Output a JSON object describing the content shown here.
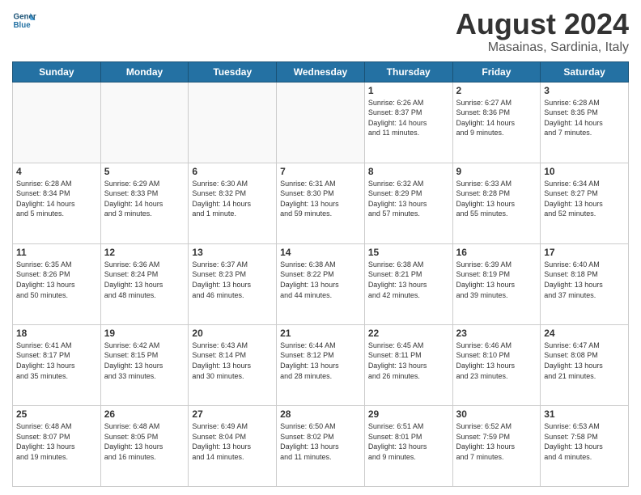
{
  "header": {
    "logo_line1": "General",
    "logo_line2": "Blue",
    "main_title": "August 2024",
    "subtitle": "Masainas, Sardinia, Italy"
  },
  "weekdays": [
    "Sunday",
    "Monday",
    "Tuesday",
    "Wednesday",
    "Thursday",
    "Friday",
    "Saturday"
  ],
  "weeks": [
    [
      {
        "day": "",
        "info": ""
      },
      {
        "day": "",
        "info": ""
      },
      {
        "day": "",
        "info": ""
      },
      {
        "day": "",
        "info": ""
      },
      {
        "day": "1",
        "info": "Sunrise: 6:26 AM\nSunset: 8:37 PM\nDaylight: 14 hours\nand 11 minutes."
      },
      {
        "day": "2",
        "info": "Sunrise: 6:27 AM\nSunset: 8:36 PM\nDaylight: 14 hours\nand 9 minutes."
      },
      {
        "day": "3",
        "info": "Sunrise: 6:28 AM\nSunset: 8:35 PM\nDaylight: 14 hours\nand 7 minutes."
      }
    ],
    [
      {
        "day": "4",
        "info": "Sunrise: 6:28 AM\nSunset: 8:34 PM\nDaylight: 14 hours\nand 5 minutes."
      },
      {
        "day": "5",
        "info": "Sunrise: 6:29 AM\nSunset: 8:33 PM\nDaylight: 14 hours\nand 3 minutes."
      },
      {
        "day": "6",
        "info": "Sunrise: 6:30 AM\nSunset: 8:32 PM\nDaylight: 14 hours\nand 1 minute."
      },
      {
        "day": "7",
        "info": "Sunrise: 6:31 AM\nSunset: 8:30 PM\nDaylight: 13 hours\nand 59 minutes."
      },
      {
        "day": "8",
        "info": "Sunrise: 6:32 AM\nSunset: 8:29 PM\nDaylight: 13 hours\nand 57 minutes."
      },
      {
        "day": "9",
        "info": "Sunrise: 6:33 AM\nSunset: 8:28 PM\nDaylight: 13 hours\nand 55 minutes."
      },
      {
        "day": "10",
        "info": "Sunrise: 6:34 AM\nSunset: 8:27 PM\nDaylight: 13 hours\nand 52 minutes."
      }
    ],
    [
      {
        "day": "11",
        "info": "Sunrise: 6:35 AM\nSunset: 8:26 PM\nDaylight: 13 hours\nand 50 minutes."
      },
      {
        "day": "12",
        "info": "Sunrise: 6:36 AM\nSunset: 8:24 PM\nDaylight: 13 hours\nand 48 minutes."
      },
      {
        "day": "13",
        "info": "Sunrise: 6:37 AM\nSunset: 8:23 PM\nDaylight: 13 hours\nand 46 minutes."
      },
      {
        "day": "14",
        "info": "Sunrise: 6:38 AM\nSunset: 8:22 PM\nDaylight: 13 hours\nand 44 minutes."
      },
      {
        "day": "15",
        "info": "Sunrise: 6:38 AM\nSunset: 8:21 PM\nDaylight: 13 hours\nand 42 minutes."
      },
      {
        "day": "16",
        "info": "Sunrise: 6:39 AM\nSunset: 8:19 PM\nDaylight: 13 hours\nand 39 minutes."
      },
      {
        "day": "17",
        "info": "Sunrise: 6:40 AM\nSunset: 8:18 PM\nDaylight: 13 hours\nand 37 minutes."
      }
    ],
    [
      {
        "day": "18",
        "info": "Sunrise: 6:41 AM\nSunset: 8:17 PM\nDaylight: 13 hours\nand 35 minutes."
      },
      {
        "day": "19",
        "info": "Sunrise: 6:42 AM\nSunset: 8:15 PM\nDaylight: 13 hours\nand 33 minutes."
      },
      {
        "day": "20",
        "info": "Sunrise: 6:43 AM\nSunset: 8:14 PM\nDaylight: 13 hours\nand 30 minutes."
      },
      {
        "day": "21",
        "info": "Sunrise: 6:44 AM\nSunset: 8:12 PM\nDaylight: 13 hours\nand 28 minutes."
      },
      {
        "day": "22",
        "info": "Sunrise: 6:45 AM\nSunset: 8:11 PM\nDaylight: 13 hours\nand 26 minutes."
      },
      {
        "day": "23",
        "info": "Sunrise: 6:46 AM\nSunset: 8:10 PM\nDaylight: 13 hours\nand 23 minutes."
      },
      {
        "day": "24",
        "info": "Sunrise: 6:47 AM\nSunset: 8:08 PM\nDaylight: 13 hours\nand 21 minutes."
      }
    ],
    [
      {
        "day": "25",
        "info": "Sunrise: 6:48 AM\nSunset: 8:07 PM\nDaylight: 13 hours\nand 19 minutes."
      },
      {
        "day": "26",
        "info": "Sunrise: 6:48 AM\nSunset: 8:05 PM\nDaylight: 13 hours\nand 16 minutes."
      },
      {
        "day": "27",
        "info": "Sunrise: 6:49 AM\nSunset: 8:04 PM\nDaylight: 13 hours\nand 14 minutes."
      },
      {
        "day": "28",
        "info": "Sunrise: 6:50 AM\nSunset: 8:02 PM\nDaylight: 13 hours\nand 11 minutes."
      },
      {
        "day": "29",
        "info": "Sunrise: 6:51 AM\nSunset: 8:01 PM\nDaylight: 13 hours\nand 9 minutes."
      },
      {
        "day": "30",
        "info": "Sunrise: 6:52 AM\nSunset: 7:59 PM\nDaylight: 13 hours\nand 7 minutes."
      },
      {
        "day": "31",
        "info": "Sunrise: 6:53 AM\nSunset: 7:58 PM\nDaylight: 13 hours\nand 4 minutes."
      }
    ]
  ]
}
